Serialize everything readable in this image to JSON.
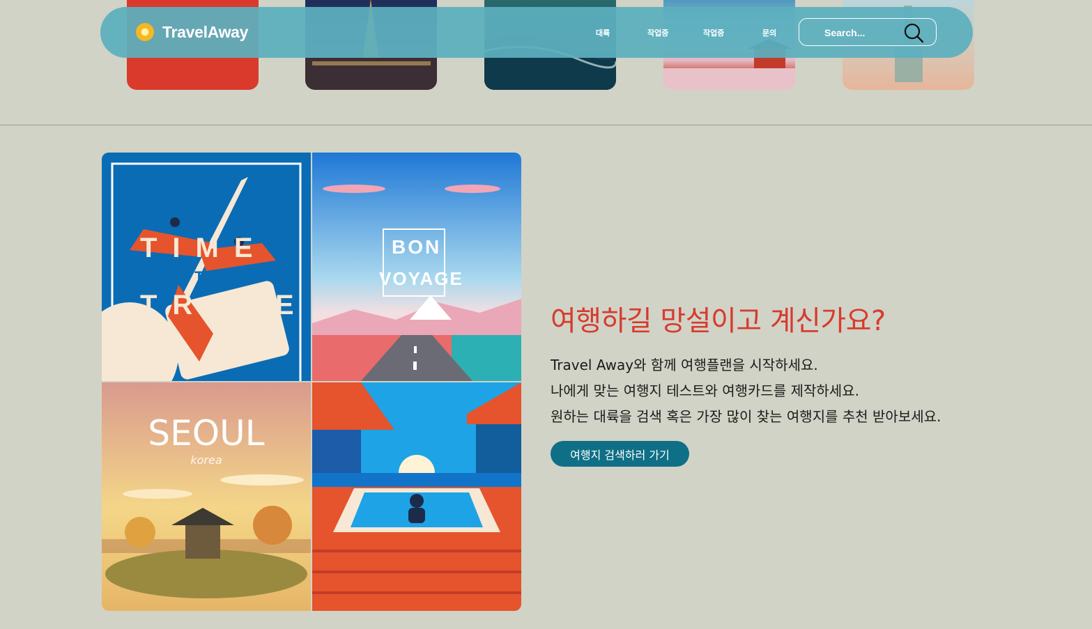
{
  "header": {
    "logo_text": "TravelAway",
    "nav": [
      "대륙",
      "작업중",
      "작업중",
      "문의"
    ],
    "search_placeholder": "Search..."
  },
  "posters": {
    "time_to_travel": [
      "TIME",
      "TO",
      "TRAVEL"
    ],
    "bon_voyage": [
      "BON",
      "VOYAGE"
    ],
    "seoul": {
      "title": "SEOUL",
      "subtitle": "korea"
    }
  },
  "hero": {
    "headline": "여행하길 망설이고 계신가요?",
    "lines": [
      "Travel Away와 함께 여행플랜을 시작하세요.",
      "나에게 맞는 여행지 테스트와 여행카드를 제작하세요.",
      "원하는 대륙을 검색 혹은 가장 많이 찾는 여행지를 추천 받아보세요."
    ],
    "cta_label": "여행지 검색하러 가기"
  },
  "colors": {
    "background": "#d1d3c6",
    "nav_bar": "#5cafbe",
    "headline": "#d63b2f",
    "cta": "#0f6f86"
  }
}
